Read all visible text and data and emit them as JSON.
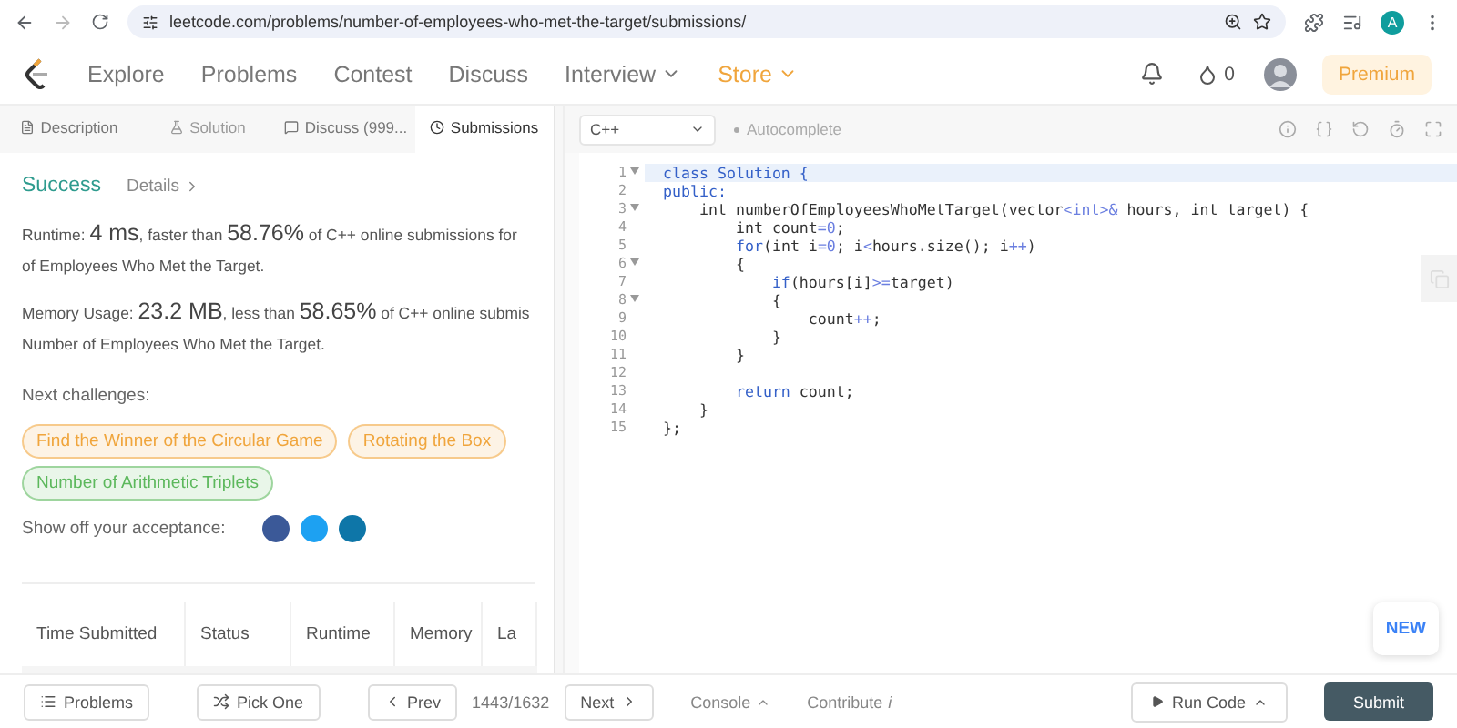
{
  "browser": {
    "url": "leetcode.com/problems/number-of-employees-who-met-the-target/submissions/",
    "profile_initial": "A"
  },
  "nav": {
    "items": [
      {
        "label": "Explore",
        "kind": "plain"
      },
      {
        "label": "Problems",
        "kind": "plain"
      },
      {
        "label": "Contest",
        "kind": "plain"
      },
      {
        "label": "Discuss",
        "kind": "plain"
      },
      {
        "label": "Interview",
        "kind": "dropdown"
      },
      {
        "label": "Store",
        "kind": "store"
      }
    ],
    "streak": "0",
    "premium": "Premium"
  },
  "tabs": [
    {
      "label": "Description",
      "selected": false,
      "disabled": false
    },
    {
      "label": "Solution",
      "selected": false,
      "disabled": true
    },
    {
      "label": "Discuss (999...",
      "selected": false,
      "disabled": false
    },
    {
      "label": "Submissions",
      "selected": true,
      "disabled": false
    }
  ],
  "result": {
    "status": "Success",
    "details": "Details",
    "stats": [
      {
        "parts": [
          {
            "text": "Runtime: ",
            "big": false
          },
          {
            "text": "4 ms",
            "big": true
          },
          {
            "text": ", faster than ",
            "big": false
          },
          {
            "text": "58.76%",
            "big": true
          },
          {
            "text": " of C++ online submissions for",
            "big": false
          }
        ],
        "continuation": "of Employees Who Met the Target."
      },
      {
        "parts": [
          {
            "text": "Memory Usage: ",
            "big": false
          },
          {
            "text": "23.2 MB",
            "big": true
          },
          {
            "text": ", less than ",
            "big": false
          },
          {
            "text": "58.65%",
            "big": true
          },
          {
            "text": " of C++ online submis",
            "big": false
          }
        ],
        "continuation": "Number of Employees Who Met the Target."
      }
    ],
    "next_label": "Next challenges:",
    "challenges": [
      {
        "title": "Find the Winner of the Circular Game",
        "color": "#f0a53c"
      },
      {
        "title": "Rotating the Box",
        "color": "#f0a53c"
      },
      {
        "title": "Number of Arithmetic Triplets",
        "color": "#5cb85c"
      }
    ],
    "share_label": "Show off your acceptance:"
  },
  "table": {
    "columns": [
      "Time Submitted",
      "Status",
      "Runtime",
      "Memory",
      "La"
    ]
  },
  "editor": {
    "language": "C++",
    "autocomplete": "Autocomplete",
    "new_badge": "NEW",
    "lines": [
      {
        "number": "1",
        "fold": true,
        "selected": true,
        "tokens": [
          {
            "text": "class Solution {",
            "kind": "keyword"
          }
        ]
      },
      {
        "number": "2",
        "fold": false,
        "selected": false,
        "tokens": [
          {
            "text": "public:",
            "kind": "keyword"
          }
        ]
      },
      {
        "number": "3",
        "fold": true,
        "selected": false,
        "tokens": [
          {
            "text": "    int numberOfEmployeesWhoMetTarget(vector",
            "kind": "plain"
          },
          {
            "text": "<int>&",
            "kind": "operator"
          },
          {
            "text": " hours, int target) {",
            "kind": "plain"
          }
        ]
      },
      {
        "number": "4",
        "fold": false,
        "selected": false,
        "tokens": [
          {
            "text": "        int count",
            "kind": "plain"
          },
          {
            "text": "=0",
            "kind": "operator"
          },
          {
            "text": ";",
            "kind": "plain"
          }
        ]
      },
      {
        "number": "5",
        "fold": false,
        "selected": false,
        "tokens": [
          {
            "text": "        for",
            "kind": "keyword"
          },
          {
            "text": "(int i",
            "kind": "plain"
          },
          {
            "text": "=0",
            "kind": "operator"
          },
          {
            "text": "; i",
            "kind": "plain"
          },
          {
            "text": "<",
            "kind": "operator"
          },
          {
            "text": "hours.size(); i",
            "kind": "plain"
          },
          {
            "text": "++",
            "kind": "operator"
          },
          {
            "text": ")",
            "kind": "plain"
          }
        ]
      },
      {
        "number": "6",
        "fold": true,
        "selected": false,
        "tokens": [
          {
            "text": "        {",
            "kind": "plain"
          }
        ]
      },
      {
        "number": "7",
        "fold": false,
        "selected": false,
        "tokens": [
          {
            "text": "            if",
            "kind": "keyword"
          },
          {
            "text": "(hours[i]",
            "kind": "plain"
          },
          {
            "text": ">=",
            "kind": "operator"
          },
          {
            "text": "target)",
            "kind": "plain"
          }
        ]
      },
      {
        "number": "8",
        "fold": true,
        "selected": false,
        "tokens": [
          {
            "text": "            {",
            "kind": "plain"
          }
        ]
      },
      {
        "number": "9",
        "fold": false,
        "selected": false,
        "tokens": [
          {
            "text": "                count",
            "kind": "plain"
          },
          {
            "text": "++",
            "kind": "operator"
          },
          {
            "text": ";",
            "kind": "plain"
          }
        ]
      },
      {
        "number": "10",
        "fold": false,
        "selected": false,
        "tokens": [
          {
            "text": "            }",
            "kind": "plain"
          }
        ]
      },
      {
        "number": "11",
        "fold": false,
        "selected": false,
        "tokens": [
          {
            "text": "        }",
            "kind": "plain"
          }
        ]
      },
      {
        "number": "12",
        "fold": false,
        "selected": false
      },
      {
        "number": "13",
        "fold": false,
        "selected": false,
        "tokens": [
          {
            "text": "        return",
            "kind": "keyword"
          },
          {
            "text": " count;",
            "kind": "plain"
          }
        ]
      },
      {
        "number": "14",
        "fold": false,
        "selected": false,
        "tokens": [
          {
            "text": "    }",
            "kind": "plain"
          }
        ]
      },
      {
        "number": "15",
        "fold": false,
        "selected": false,
        "tokens": [
          {
            "text": "};",
            "kind": "plain"
          }
        ]
      }
    ]
  },
  "footer": {
    "problems": "Problems",
    "pick_one": "Pick One",
    "prev": "Prev",
    "counter": "1443/1632",
    "next": "Next",
    "console": "Console",
    "contribute": "Contribute",
    "contribute_mark": "i",
    "run": "Run Code",
    "submit": "Submit"
  }
}
